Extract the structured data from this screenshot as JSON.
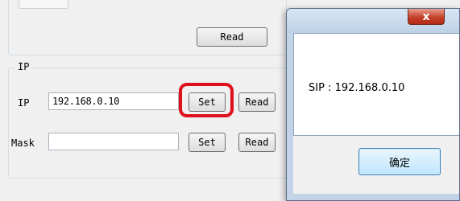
{
  "top_group": {
    "read_label": "Read"
  },
  "ip_group": {
    "title": "IP",
    "ip_label": "IP",
    "ip_value": "192.168.0.10",
    "set_label": "Set",
    "read_label": "Read",
    "mask_label": "Mask",
    "mask_value": "",
    "mask_set_label": "Set",
    "mask_read_label": "Read"
  },
  "dialog": {
    "close_label": "x",
    "message": "SIP : 192.168.0.10",
    "ok_label": "确定"
  },
  "colors": {
    "highlight": "#e0101a",
    "close_button": "#c4412b"
  }
}
